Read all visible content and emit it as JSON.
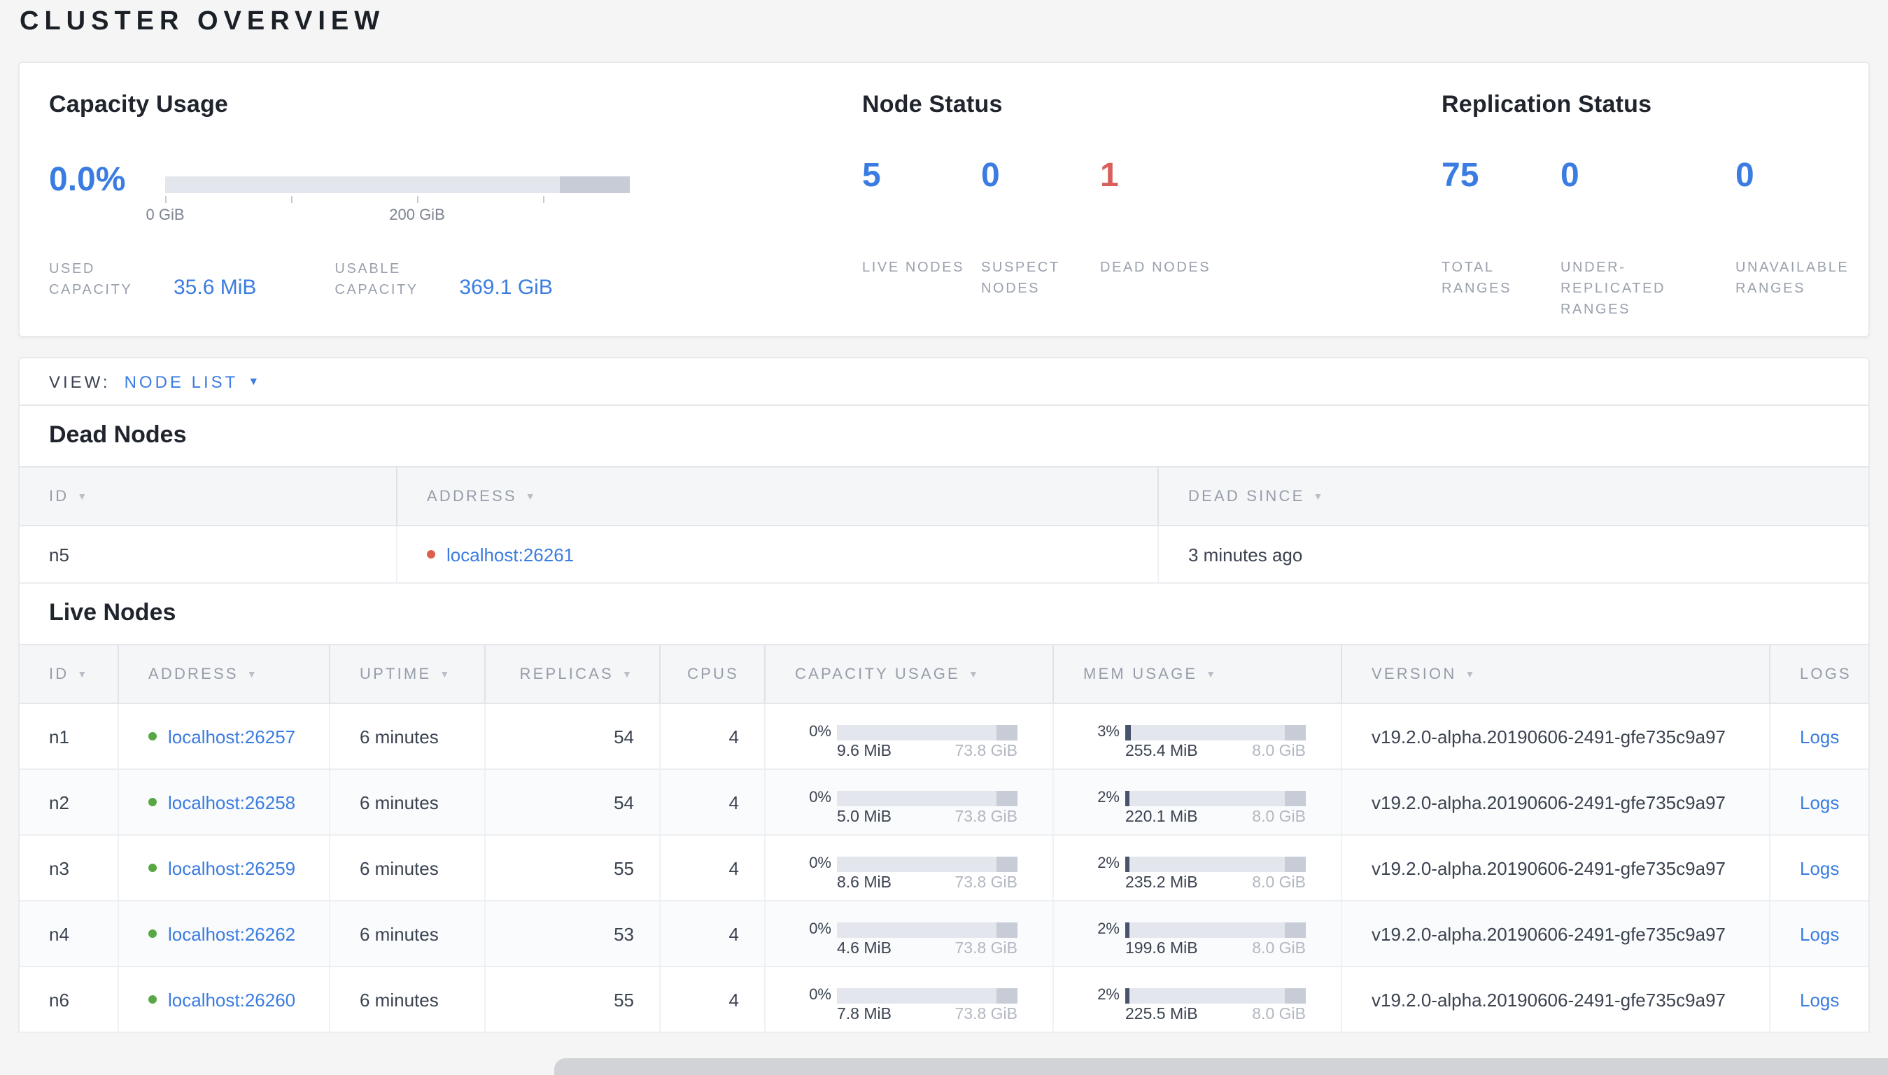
{
  "page_title": "CLUSTER OVERVIEW",
  "colors": {
    "accent_blue": "#3a7ce1",
    "dead_red": "#d85f5b",
    "live_dot_green": "#57a845",
    "dead_dot_red": "#dd5f4d",
    "bar_track": "#e3e6ec",
    "bar_cap": "#c7ccd6",
    "mem_fill": "#49536b"
  },
  "summary": {
    "capacity": {
      "heading": "Capacity Usage",
      "percent": "0.0%",
      "tick_labels": [
        "0 GiB",
        "200 GiB"
      ],
      "used_label": "USED CAPACITY",
      "used_value": "35.6 MiB",
      "usable_label": "USABLE CAPACITY",
      "usable_value": "369.1 GiB"
    },
    "node_status": {
      "heading": "Node Status",
      "stats": [
        {
          "value": "5",
          "label": "LIVE NODES"
        },
        {
          "value": "0",
          "label": "SUSPECT NODES"
        },
        {
          "value": "1",
          "label": "DEAD NODES"
        }
      ]
    },
    "replication": {
      "heading": "Replication Status",
      "stats": [
        {
          "value": "75",
          "label": "TOTAL RANGES"
        },
        {
          "value": "0",
          "label": "UNDER-REPLICATED RANGES"
        },
        {
          "value": "0",
          "label": "UNAVAILABLE RANGES"
        }
      ]
    }
  },
  "view_bar": {
    "label": "VIEW:",
    "selected": "NODE LIST"
  },
  "dead_nodes": {
    "heading": "Dead Nodes",
    "columns": [
      "ID",
      "ADDRESS",
      "DEAD SINCE"
    ],
    "rows": [
      {
        "id": "n5",
        "address": "localhost:26261",
        "dead_since": "3 minutes ago"
      }
    ]
  },
  "live_nodes": {
    "heading": "Live Nodes",
    "columns": [
      "ID",
      "ADDRESS",
      "UPTIME",
      "REPLICAS",
      "CPUS",
      "CAPACITY USAGE",
      "MEM USAGE",
      "VERSION",
      "LOGS"
    ],
    "rows": [
      {
        "id": "n1",
        "address": "localhost:26257",
        "uptime": "6 minutes",
        "replicas": "54",
        "cpus": "4",
        "cap_pct": "0%",
        "cap_fill": 0,
        "cap_used": "9.6 MiB",
        "cap_total": "73.8 GiB",
        "mem_pct": "3%",
        "mem_fill": 3,
        "mem_used": "255.4 MiB",
        "mem_total": "8.0 GiB",
        "version": "v19.2.0-alpha.20190606-2491-gfe735c9a97",
        "logs": "Logs"
      },
      {
        "id": "n2",
        "address": "localhost:26258",
        "uptime": "6 minutes",
        "replicas": "54",
        "cpus": "4",
        "cap_pct": "0%",
        "cap_fill": 0,
        "cap_used": "5.0 MiB",
        "cap_total": "73.8 GiB",
        "mem_pct": "2%",
        "mem_fill": 2.5,
        "mem_used": "220.1 MiB",
        "mem_total": "8.0 GiB",
        "version": "v19.2.0-alpha.20190606-2491-gfe735c9a97",
        "logs": "Logs"
      },
      {
        "id": "n3",
        "address": "localhost:26259",
        "uptime": "6 minutes",
        "replicas": "55",
        "cpus": "4",
        "cap_pct": "0%",
        "cap_fill": 0,
        "cap_used": "8.6 MiB",
        "cap_total": "73.8 GiB",
        "mem_pct": "2%",
        "mem_fill": 2.5,
        "mem_used": "235.2 MiB",
        "mem_total": "8.0 GiB",
        "version": "v19.2.0-alpha.20190606-2491-gfe735c9a97",
        "logs": "Logs"
      },
      {
        "id": "n4",
        "address": "localhost:26262",
        "uptime": "6 minutes",
        "replicas": "53",
        "cpus": "4",
        "cap_pct": "0%",
        "cap_fill": 0,
        "cap_used": "4.6 MiB",
        "cap_total": "73.8 GiB",
        "mem_pct": "2%",
        "mem_fill": 2.5,
        "mem_used": "199.6 MiB",
        "mem_total": "8.0 GiB",
        "version": "v19.2.0-alpha.20190606-2491-gfe735c9a97",
        "logs": "Logs"
      },
      {
        "id": "n6",
        "address": "localhost:26260",
        "uptime": "6 minutes",
        "replicas": "55",
        "cpus": "4",
        "cap_pct": "0%",
        "cap_fill": 0,
        "cap_used": "7.8 MiB",
        "cap_total": "73.8 GiB",
        "mem_pct": "2%",
        "mem_fill": 2.5,
        "mem_used": "225.5 MiB",
        "mem_total": "8.0 GiB",
        "version": "v19.2.0-alpha.20190606-2491-gfe735c9a97",
        "logs": "Logs"
      }
    ]
  }
}
